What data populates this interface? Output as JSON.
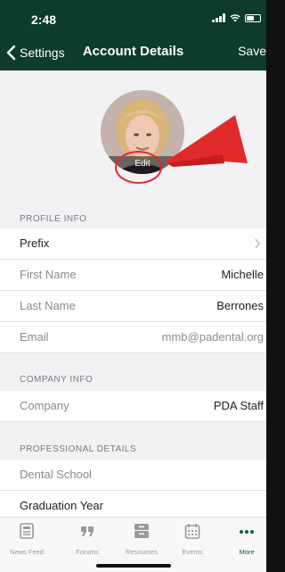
{
  "status_bar": {
    "time": "2:48"
  },
  "nav": {
    "back_label": "Settings",
    "title": "Account Details",
    "save_label": "Save"
  },
  "avatar": {
    "edit_label": "Edit"
  },
  "sections": {
    "profile": {
      "header": "PROFILE INFO",
      "rows": [
        {
          "label": "Prefix",
          "value": ""
        },
        {
          "label": "First Name",
          "value": "Michelle"
        },
        {
          "label": "Last Name",
          "value": "Berrones"
        },
        {
          "label": "Email",
          "value": "mmb@padental.org"
        }
      ]
    },
    "company": {
      "header": "COMPANY INFO",
      "rows": [
        {
          "label": "Company",
          "value": "PDA Staff"
        }
      ]
    },
    "professional": {
      "header": "PROFESSIONAL DETAILS",
      "rows": [
        {
          "label": "Dental School",
          "value": ""
        },
        {
          "label": "Graduation Year",
          "value": ""
        }
      ]
    }
  },
  "tabbar": {
    "tabs": [
      {
        "label": "News Feed",
        "icon": "news-feed-icon"
      },
      {
        "label": "Forums",
        "icon": "quote-icon"
      },
      {
        "label": "Resources",
        "icon": "archive-box-icon"
      },
      {
        "label": "Events",
        "icon": "calendar-icon"
      },
      {
        "label": "More",
        "icon": "more-dots-icon"
      }
    ]
  },
  "colors": {
    "nav_bg": "#0d3b2c",
    "accent": "#0d5b40",
    "annotation": "#e02a2a"
  }
}
